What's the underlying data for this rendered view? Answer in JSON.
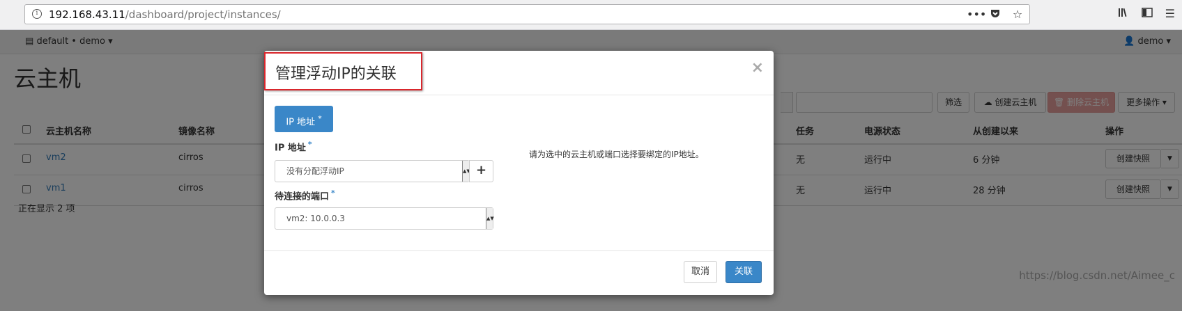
{
  "browser": {
    "url_host": "192.168.43.11",
    "url_path": "/dashboard/project/instances/",
    "page_actions_icon": "ellipsis-icon",
    "pocket_icon": "pocket-icon",
    "bookmark_icon": "star-icon"
  },
  "topnav": {
    "project": "default • demo ▾",
    "user": "demo ▾"
  },
  "page": {
    "title": "云主机",
    "toolbar": {
      "filter_label": "筛选",
      "create_label": "创建云主机",
      "delete_label": "删除云主机",
      "more_label": "更多操作 ▾"
    },
    "table": {
      "columns": [
        "云主机名称",
        "镜像名称",
        "任务",
        "电源状态",
        "从创建以来",
        "操作"
      ],
      "rows": [
        {
          "name": "vm2",
          "image": "cirros",
          "task": "无",
          "power": "运行中",
          "age": "6 分钟",
          "action": "创建快照"
        },
        {
          "name": "vm1",
          "image": "cirros",
          "task": "无",
          "power": "运行中",
          "age": "28 分钟",
          "action": "创建快照"
        }
      ]
    },
    "footer_count": "正在显示 2 项",
    "watermark": "https://blog.csdn.net/Aimee_c"
  },
  "modal": {
    "title": "管理浮动IP的关联",
    "close": "×",
    "tab_label": "IP 地址",
    "ip_label": "IP 地址",
    "ip_value": "没有分配浮动IP",
    "port_label": "待连接的端口",
    "port_value": "vm2: 10.0.0.3",
    "required_mark": "*",
    "help_text": "请为选中的云主机或端口选择要绑定的IP地址。",
    "cancel_label": "取消",
    "associate_label": "关联",
    "accent_color": "#3a87c8",
    "highlight_color": "#d9262c"
  }
}
